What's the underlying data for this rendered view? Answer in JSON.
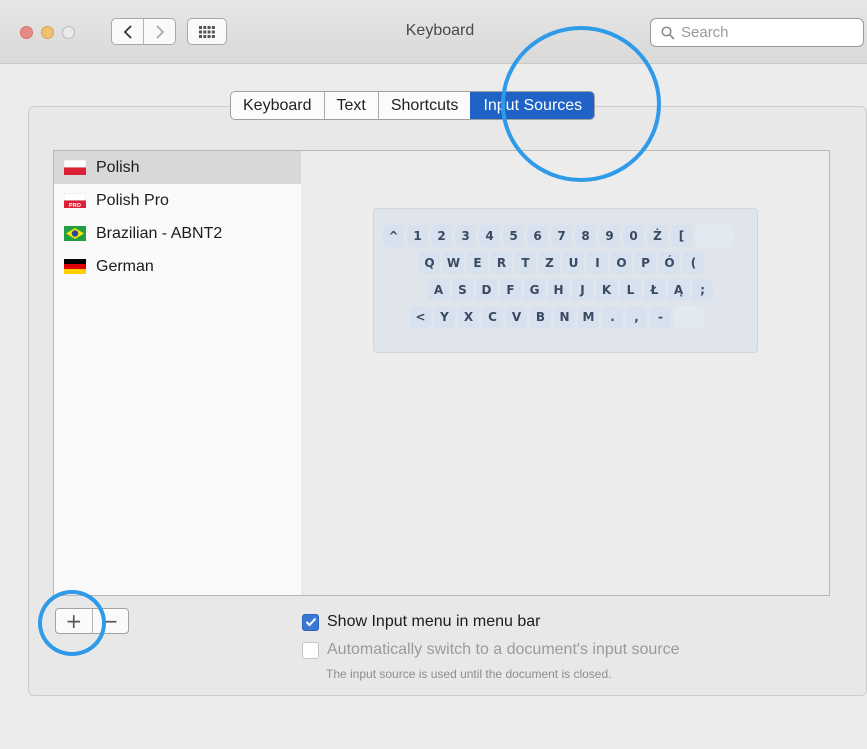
{
  "window": {
    "title": "Keyboard"
  },
  "search": {
    "placeholder": "Search"
  },
  "tabs": [
    {
      "label": "Keyboard",
      "active": false
    },
    {
      "label": "Text",
      "active": false
    },
    {
      "label": "Shortcuts",
      "active": false
    },
    {
      "label": "Input Sources",
      "active": true
    }
  ],
  "input_sources": [
    {
      "label": "Polish",
      "flag": "polish-flag",
      "selected": true
    },
    {
      "label": "Polish Pro",
      "flag": "polish-pro-flag",
      "selected": false
    },
    {
      "label": "Brazilian - ABNT2",
      "flag": "brazil-flag",
      "selected": false
    },
    {
      "label": "German",
      "flag": "german-flag",
      "selected": false
    }
  ],
  "keyboard": {
    "row1": [
      "^",
      "1",
      "2",
      "3",
      "4",
      "5",
      "6",
      "7",
      "8",
      "9",
      "0",
      "Ż",
      "["
    ],
    "row2": [
      "Q",
      "W",
      "E",
      "R",
      "T",
      "Z",
      "U",
      "I",
      "O",
      "P",
      "Ó",
      "("
    ],
    "row3": [
      "A",
      "S",
      "D",
      "F",
      "G",
      "H",
      "J",
      "K",
      "L",
      "Ł",
      "Ą",
      ";"
    ],
    "row4": [
      "<",
      "Y",
      "X",
      "C",
      "V",
      "B",
      "N",
      "M",
      ".",
      ",",
      "-"
    ]
  },
  "buttons": {
    "add": "+",
    "remove": "−"
  },
  "options": {
    "show_menu": {
      "label": "Show Input menu in menu bar",
      "checked": true
    },
    "auto_switch": {
      "label": "Automatically switch to a document's input source",
      "checked": false
    },
    "note": "The input source is used until the document is closed."
  },
  "colors": {
    "accent": "#1f63c7",
    "annotation": "#2f9ae8"
  }
}
